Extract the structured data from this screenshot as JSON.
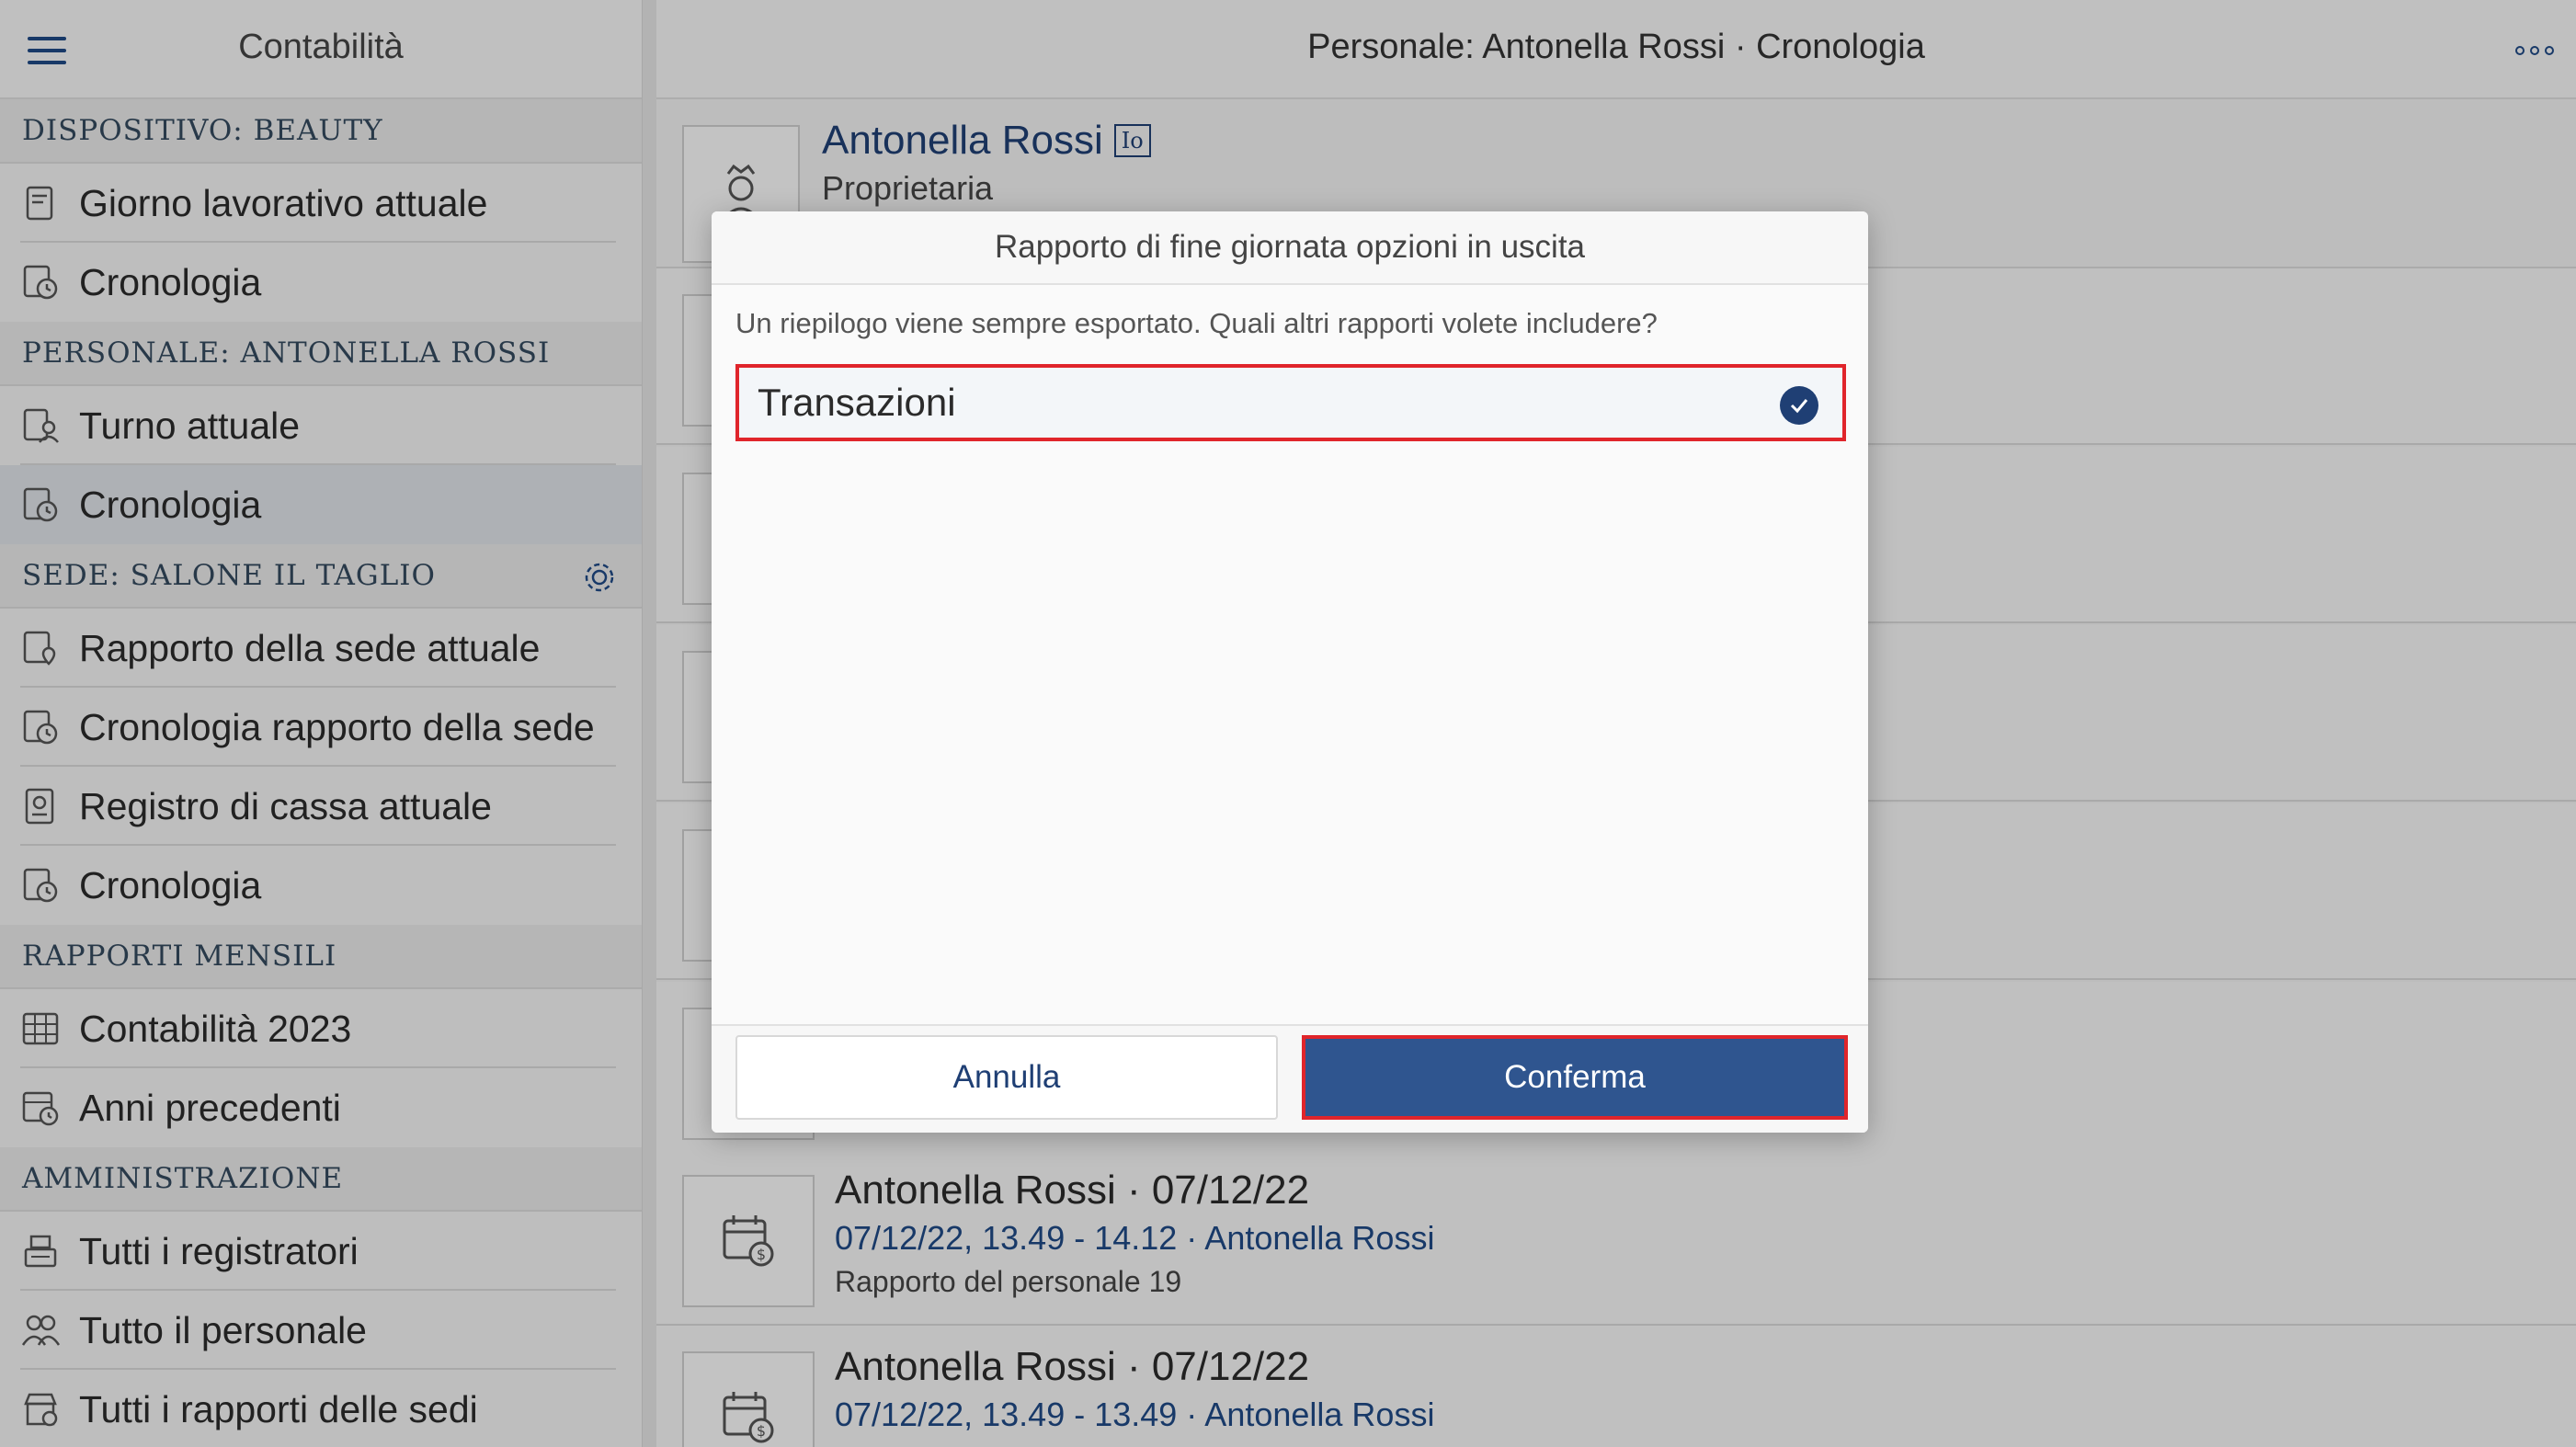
{
  "sidebar": {
    "title": "Contabilità",
    "sections": [
      {
        "header": "DISPOSITIVO: BEAUTY",
        "items": [
          {
            "label": "Giorno lavorativo attuale",
            "icon": "receipt-icon"
          },
          {
            "label": "Cronologia",
            "icon": "history-icon"
          }
        ]
      },
      {
        "header": "PERSONALE: ANTONELLA ROSSI",
        "items": [
          {
            "label": "Turno attuale",
            "icon": "staff-receipt-icon"
          },
          {
            "label": "Cronologia",
            "icon": "history-icon",
            "active": true
          }
        ]
      },
      {
        "header": "SEDE: SALONE IL TAGLIO",
        "has_settings": true,
        "items": [
          {
            "label": "Rapporto della sede attuale",
            "icon": "location-report-icon"
          },
          {
            "label": "Cronologia rapporto della sede",
            "icon": "history-icon"
          },
          {
            "label": "Registro di cassa attuale",
            "icon": "cash-register-icon"
          },
          {
            "label": "Cronologia",
            "icon": "history-icon"
          }
        ]
      },
      {
        "header": "RAPPORTI MENSILI",
        "items": [
          {
            "label": "Contabilità 2023",
            "icon": "calendar-grid-icon"
          },
          {
            "label": "Anni precedenti",
            "icon": "calendar-history-icon"
          }
        ]
      },
      {
        "header": "AMMINISTRAZIONE",
        "items": [
          {
            "label": "Tutti i registratori",
            "icon": "register-icon"
          },
          {
            "label": "Tutto il personale",
            "icon": "people-icon"
          },
          {
            "label": "Tutti i rapporti delle sedi",
            "icon": "store-icon"
          }
        ]
      }
    ]
  },
  "main": {
    "title": "Personale: Antonella Rossi · Cronologia",
    "profile": {
      "name": "Antonella Rossi",
      "badge": "Io",
      "role": "Proprietaria"
    },
    "rows": [
      {
        "title": "Antonella Rossi · 07/12/22",
        "sub": "07/12/22, 13.49 - 14.12 · Antonella Rossi",
        "meta": "Rapporto del personale 19"
      },
      {
        "title": "Antonella Rossi · 07/12/22",
        "sub": "07/12/22, 13.49 - 13.49 · Antonella Rossi",
        "meta": ""
      }
    ]
  },
  "dialog": {
    "title": "Rapporto di fine giornata opzioni in uscita",
    "description": "Un riepilogo viene sempre esportato. Quali altri rapporti volete includere?",
    "option_label": "Transazioni",
    "option_checked": true,
    "cancel_label": "Annulla",
    "confirm_label": "Conferma"
  },
  "colors": {
    "accent": "#1f3f74",
    "confirm_bg": "#2f558f",
    "highlight": "#e0252b"
  }
}
